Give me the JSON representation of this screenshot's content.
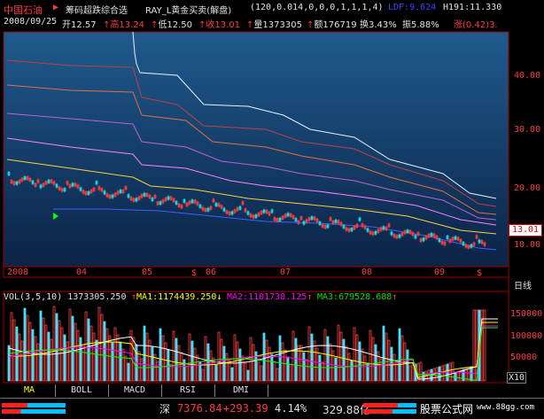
{
  "header": {
    "stock_name": "中国石油",
    "indicator": "筹码超跌综合选",
    "formula": "RAY_L黄金买卖(解盘)",
    "params": "(120,0.014,0,0,0,1,1,1,4)",
    "ldf": "LDF:9.624",
    "h191": "H191:11.330"
  },
  "quote": {
    "date": "2008/09/25",
    "open": "开12.57",
    "high": "高13.24",
    "low": "低12.50",
    "close": "收13.01",
    "volume": "量1373305",
    "amount": "额176719",
    "turnover": "换3.43%",
    "amplitude": "振5.88%",
    "change": "涨(0.42)3."
  },
  "price_axis": {
    "labels": [
      "40.00",
      "30.00",
      "20.00",
      "10.00"
    ],
    "current": "13.01",
    "period": "日线"
  },
  "time_axis": [
    "2008",
    "04",
    "05",
    "06",
    "07",
    "08",
    "09"
  ],
  "volume_panel": {
    "vol": "VOL(3,5,10) 1373305.250",
    "ma1": "MA1:1174439.250",
    "ma2": "MA2:1101738.125",
    "ma3": "MA3:679528.688",
    "axis": [
      "150000",
      "100000",
      "50000"
    ],
    "scale": "X10"
  },
  "tabs": [
    "MA",
    "BOLL",
    "MACD",
    "RSI",
    "DMI"
  ],
  "statusbar": {
    "index": "深",
    "value": "7376.84",
    "change": "+293.39",
    "pct": "4.14%",
    "turnover": "329.88亿",
    "brand": "股票公式网",
    "url": "www.88gg.com"
  },
  "colors": {
    "up": "#ff3c3c",
    "down": "#00ffff",
    "bg_top": "#123a6a",
    "bg_bottom": "#0a1f40"
  }
}
